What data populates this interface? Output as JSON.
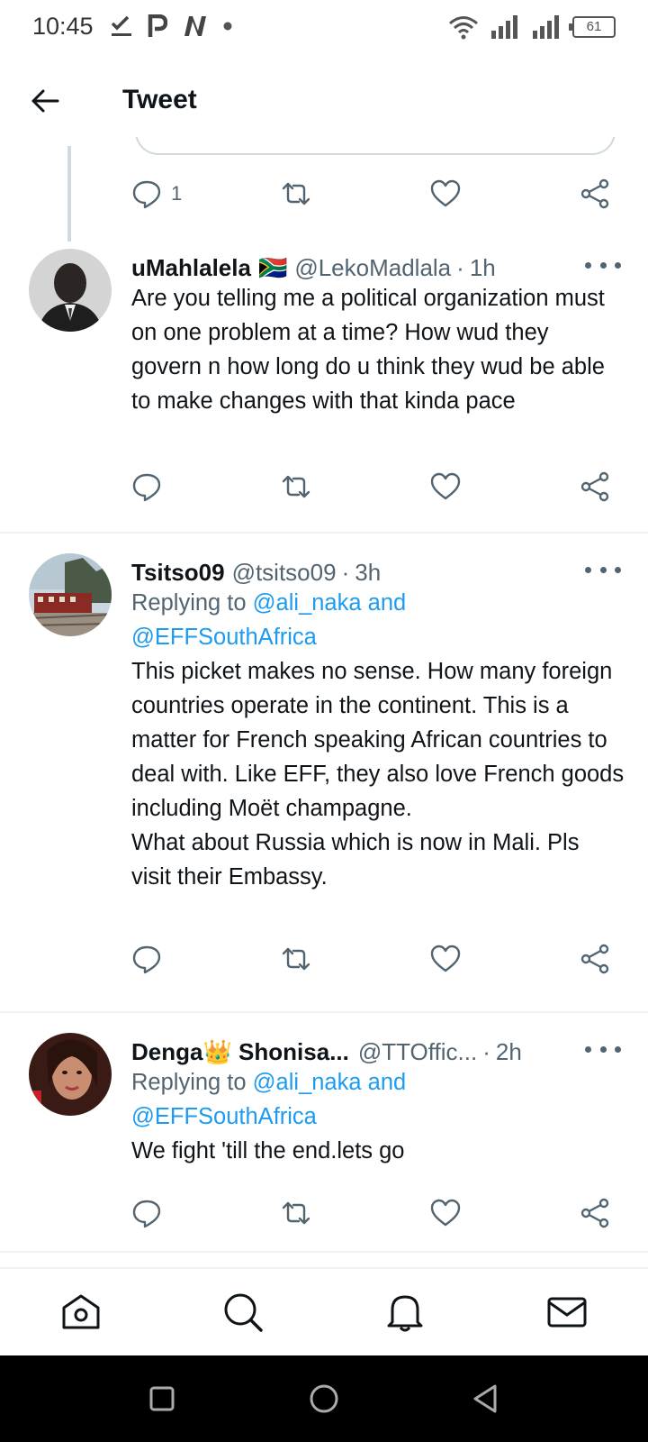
{
  "status_bar": {
    "time": "10:45",
    "battery": "61"
  },
  "header": {
    "title": "Tweet"
  },
  "prev_tweet": {
    "reply_count": "1"
  },
  "tweets": [
    {
      "name": "uMahlalela",
      "flag": "🇿🇦",
      "handle": "@LekoMadlala",
      "time": "1h",
      "text": "Are you telling me a political organization must on one problem at a time? How wud they govern n how long do u think they wud be able to make changes with that kinda pace"
    },
    {
      "name": "Tsitso09",
      "handle": "@tsitso09",
      "time": "3h",
      "replying_prefix": "Replying to",
      "replying_mention_1": "@ali_naka",
      "replying_and": "and",
      "replying_mention_2": "@EFFSouthAfrica",
      "text_line_1": "This picket makes no sense. How many foreign countries operate in the continent. This is a matter for French speaking African countries to deal with. Like EFF, they also love French goods including Moët champagne.",
      "text_line_2": "What about Russia which is now in Mali. Pls visit their Embassy."
    },
    {
      "name": "Denga👑 Shonisa...",
      "handle": "@TTOffic...",
      "time": "2h",
      "replying_prefix": "Replying to",
      "replying_mention_1": "@ali_naka",
      "replying_and": "and",
      "replying_mention_2": "@EFFSouthAfrica",
      "text": "We fight 'till the end.lets go"
    }
  ],
  "time_separator": "·",
  "colors": {
    "accent": "#1d9bf0",
    "secondary_text": "#536471",
    "divider": "#eff3f4"
  },
  "bottom_nav": [
    "home-icon",
    "search-icon",
    "notifications-icon",
    "messages-icon"
  ]
}
